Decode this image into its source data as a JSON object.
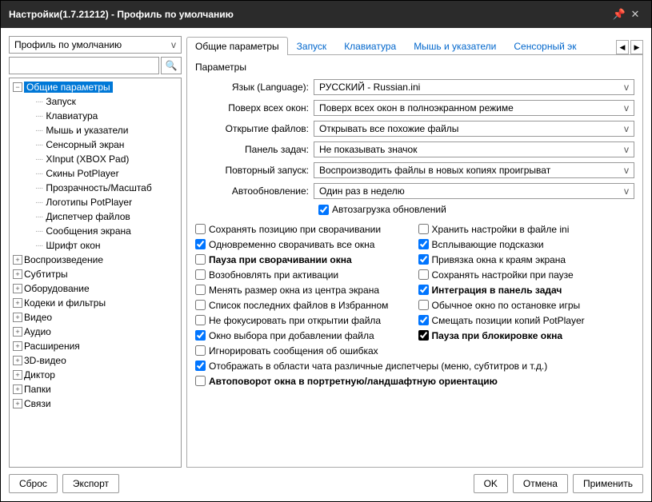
{
  "window": {
    "title": "Настройки(1.7.21212) - Профиль по умолчанию"
  },
  "profile_selector": {
    "value": "Профиль по умолчанию"
  },
  "search": {
    "placeholder": ""
  },
  "tree": {
    "root": "Общие параметры",
    "children": [
      "Запуск",
      "Клавиатура",
      "Мышь и указатели",
      "Сенсорный экран",
      "XInput (XBOX Pad)",
      "Скины PotPlayer",
      "Прозрачность/Масштаб",
      "Логотипы PotPlayer",
      "Диспетчер файлов",
      "Сообщения экрана",
      "Шрифт окон"
    ],
    "siblings": [
      "Воспроизведение",
      "Субтитры",
      "Оборудование",
      "Кодеки и фильтры",
      "Видео",
      "Аудио",
      "Расширения",
      "3D-видео",
      "Диктор",
      "Папки",
      "Связи"
    ]
  },
  "tabs": {
    "items": [
      "Общие параметры",
      "Запуск",
      "Клавиатура",
      "Мышь и указатели",
      "Сенсорный эк"
    ],
    "active": 0
  },
  "panel": {
    "group_label": "Параметры",
    "rows": [
      {
        "label": "Язык (Language):",
        "value": "РУССКИЙ - Russian.ini"
      },
      {
        "label": "Поверх всех окон:",
        "value": "Поверх всех окон в полноэкранном режиме"
      },
      {
        "label": "Открытие файлов:",
        "value": "Открывать все похожие файлы"
      },
      {
        "label": "Панель задач:",
        "value": "Не показывать значок"
      },
      {
        "label": "Повторный запуск:",
        "value": "Воспроизводить файлы в новых копиях проигрыват"
      },
      {
        "label": "Автообновление:",
        "value": "Один раз в неделю"
      }
    ],
    "autoload": {
      "label": "Автозагрузка обновлений",
      "checked": true
    },
    "checks_left": [
      {
        "label": "Сохранять позицию при сворачивании",
        "checked": false,
        "bold": false
      },
      {
        "label": "Одновременно сворачивать все окна",
        "checked": true,
        "bold": false
      },
      {
        "label": "Пауза при сворачивании окна",
        "checked": false,
        "bold": true
      },
      {
        "label": "Возобновлять при активации",
        "checked": false,
        "bold": false
      },
      {
        "label": "Менять размер окна из центра экрана",
        "checked": false,
        "bold": false
      },
      {
        "label": "Список последних файлов в Избранном",
        "checked": false,
        "bold": false
      },
      {
        "label": "Не фокусировать при открытии файла",
        "checked": false,
        "bold": false
      },
      {
        "label": "Окно выбора при добавлении файла",
        "checked": true,
        "bold": false
      },
      {
        "label": "Игнорировать сообщения об ошибках",
        "checked": false,
        "bold": false
      }
    ],
    "checks_right": [
      {
        "label": "Хранить настройки в файле ini",
        "checked": false,
        "bold": false
      },
      {
        "label": "Всплывающие подсказки",
        "checked": true,
        "bold": false
      },
      {
        "label": "Привязка окна к краям экрана",
        "checked": true,
        "bold": false
      },
      {
        "label": "Сохранять настройки при паузе",
        "checked": false,
        "bold": false
      },
      {
        "label": "Интеграция в панель задач",
        "checked": true,
        "bold": true
      },
      {
        "label": "Обычное окно по остановке игры",
        "checked": false,
        "bold": false
      },
      {
        "label": "Смещать позиции копий PotPlayer",
        "checked": true,
        "bold": false
      },
      {
        "label": "Пауза при блокировке окна",
        "checked": true,
        "bold": true,
        "indeterminate": true
      }
    ],
    "checks_full": [
      {
        "label": "Отображать в области чата различные диспетчеры (меню, субтитров и т.д.)",
        "checked": true,
        "bold": false
      },
      {
        "label": "Автоповорот окна в портретную/ландшафтную ориентацию",
        "checked": false,
        "bold": true
      }
    ]
  },
  "footer": {
    "reset": "Сброс",
    "export": "Экспорт",
    "ok": "OK",
    "cancel": "Отмена",
    "apply": "Применить"
  }
}
